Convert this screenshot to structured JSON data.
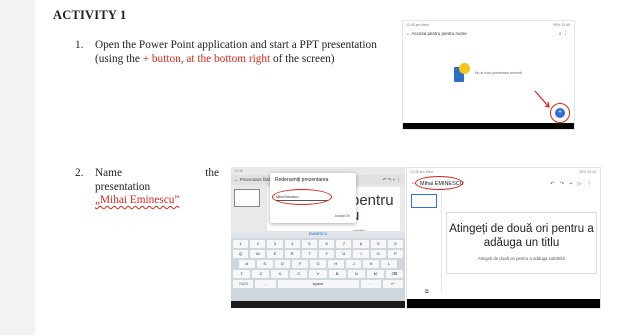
{
  "activity": {
    "heading": "ACTIVITY 1",
    "step1": {
      "number": "1.",
      "text_a": "Open the Power Point application and start a PPT presentation (using the ",
      "text_red": "+ button, at the bottom right",
      "text_b": " of the screen)"
    },
    "step2": {
      "number": "2.",
      "word_name": "Name",
      "word_the": "the",
      "word_presentation": "presentation",
      "quoted_name": "„Mihai Eminescu”"
    }
  },
  "screenshot1": {
    "status_left": "12:45 pm Wed",
    "status_right": "95% 12:45",
    "header": "←  Accesa pentru pentru nume",
    "header_icons": "⌕   ⋮",
    "message": "Nu ai nicio prezentare recentă",
    "fab_label": "+",
    "accent": "#e0251b",
    "fab_color": "#2f6fd6"
  },
  "screenshot2": {
    "status_left": "12:45",
    "titlebar": "←  Prezentare fără",
    "titlebar_icons": "↶ ↷ + ⋮",
    "dialog_title": "Redenumiți prezentarea",
    "dialog_input": "Mihai Eminescu",
    "dialog_buttons": "Anulați    OK",
    "slide_big_text": "pentru\nu",
    "slide_sub_text": "subtitlu",
    "suggestion": "EMINESCU",
    "keyboard_rows": [
      [
        "1",
        "2",
        "3",
        "4",
        "5",
        "6",
        "7",
        "8",
        "9",
        "0"
      ],
      [
        "Q",
        "W",
        "E",
        "R",
        "T",
        "Y",
        "U",
        "I",
        "O",
        "P"
      ],
      [
        "A",
        "S",
        "D",
        "F",
        "G",
        "H",
        "J",
        "K",
        "L"
      ],
      [
        "⇧",
        "Z",
        "X",
        "C",
        "V",
        "B",
        "N",
        "M",
        "⌫"
      ],
      [
        "?123",
        ",",
        "",
        "",
        "space",
        "",
        "",
        ".",
        "↵"
      ]
    ]
  },
  "screenshot3": {
    "status_left": "12:45 pm Wed",
    "status_right": "95% 12:45",
    "back_icon": "←",
    "title": "Mihai EMINESCU",
    "toolbar_icons": "↶ ↷ + ▷ ⋮",
    "slide_big_text": "Atingeți de două ori pentru a adăuga un titlu",
    "slide_sub_text": "Atingeți de două ori pentru a adăuga subtitrări",
    "bottom_icon": "⧉"
  }
}
